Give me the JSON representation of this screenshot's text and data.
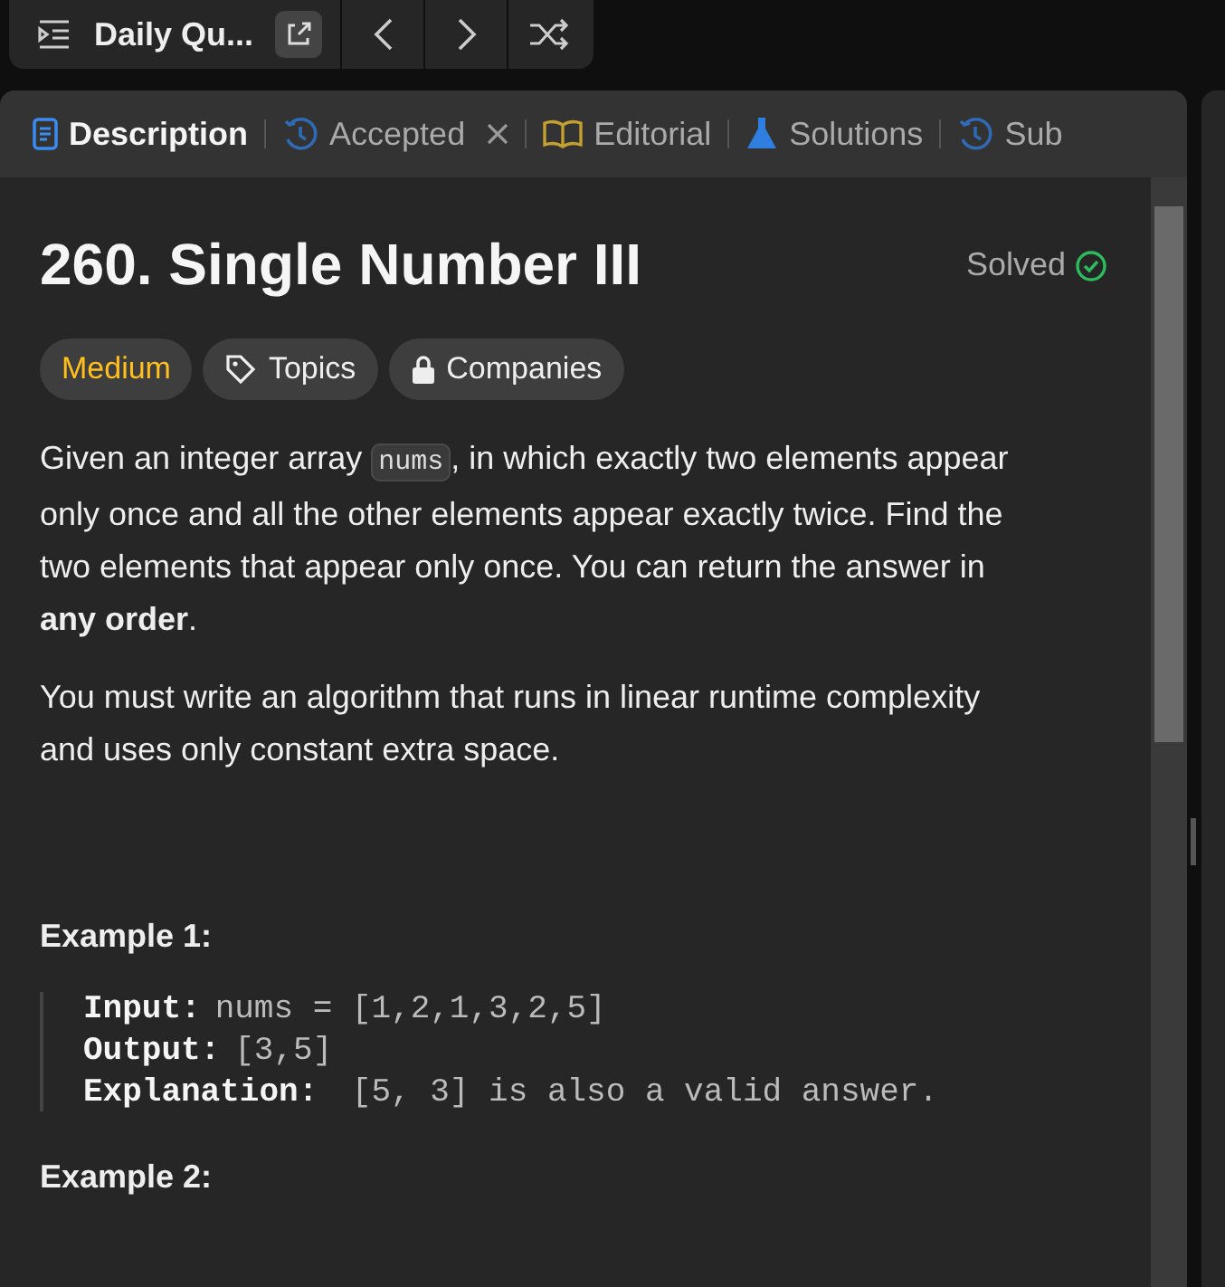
{
  "top_bar": {
    "title": "Daily Qu..."
  },
  "tabs": [
    {
      "label": "Description",
      "kind": "doc",
      "selected": true,
      "closable": false
    },
    {
      "label": "Accepted",
      "kind": "history",
      "selected": false,
      "closable": true
    },
    {
      "label": "Editorial",
      "kind": "book",
      "selected": false,
      "closable": false
    },
    {
      "label": "Solutions",
      "kind": "flask",
      "selected": false,
      "closable": false
    },
    {
      "label": "Sub",
      "kind": "history",
      "selected": false,
      "closable": false
    }
  ],
  "problem": {
    "title": "260. Single Number III",
    "status": "Solved",
    "tags": [
      {
        "label": "Medium",
        "kind": "difficulty"
      },
      {
        "label": "Topics",
        "kind": "topics"
      },
      {
        "label": "Companies",
        "kind": "companies"
      }
    ],
    "paragraphs": [
      [
        {
          "kind": "text",
          "text": "Given an integer array "
        },
        {
          "kind": "code",
          "text": "nums"
        },
        {
          "kind": "text",
          "text": ", in which exactly two elements appear only once and all the other elements appear exactly twice. Find the two elements that appear only once. You can return the answer in **any order**."
        }
      ],
      [
        {
          "kind": "text",
          "text": "You must write an algorithm that runs in linear runtime complexity and uses only constant extra space."
        }
      ]
    ],
    "examples": [
      {
        "heading": "Example 1:",
        "lines": [
          {
            "label": "Input:",
            "value": "nums = [1,2,1,3,2,5]"
          },
          {
            "label": "Output:",
            "value": "[3,5]"
          },
          {
            "label": "Explanation:",
            "value": " [5, 3] is also a valid answer."
          }
        ]
      },
      {
        "heading": "Example 2:"
      }
    ]
  }
}
